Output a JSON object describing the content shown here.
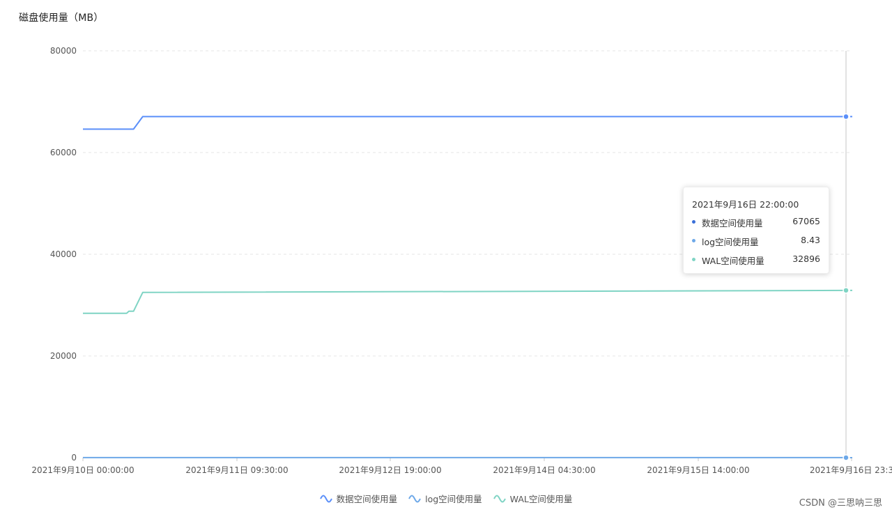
{
  "chart_data": {
    "type": "line",
    "title": "磁盘使用量（MB）",
    "xlabel": "",
    "ylabel": "",
    "ylim": [
      0,
      80000
    ],
    "yticks": [
      0,
      20000,
      40000,
      60000,
      80000
    ],
    "yticks_text": [
      "0",
      "20000",
      "40000",
      "60000",
      "80000"
    ],
    "xlim": [
      "2021-09-10 00:00:00",
      "2021-09-16 22:00:00"
    ],
    "xtick_labels": [
      "2021年9月10日 00:00:00",
      "2021年9月11日 09:30:00",
      "2021年9月12日 19:00:00",
      "2021年9月14日 04:30:00",
      "2021年9月15日 14:00:00",
      "2021年9月16日 23:3"
    ],
    "grid": "horizontal dashed",
    "legend_position": "bottom",
    "series": [
      {
        "name": "数据空间使用量",
        "color": "#5b8ff9",
        "x": [
          "2021-09-10 00:00:00",
          "2021-09-10 11:00:00",
          "2021-09-10 13:00:00",
          "2021-09-16 22:00:00"
        ],
        "y": [
          64600,
          64600,
          67065,
          67065
        ]
      },
      {
        "name": "log空间使用量",
        "color": "#6da8e8",
        "x": [
          "2021-09-10 00:00:00",
          "2021-09-16 22:00:00"
        ],
        "y": [
          8.43,
          8.43
        ]
      },
      {
        "name": "WAL空间使用量",
        "color": "#7fd4c4",
        "x": [
          "2021-09-10 00:00:00",
          "2021-09-10 09:30:00",
          "2021-09-10 10:00:00",
          "2021-09-10 11:00:00",
          "2021-09-10 13:00:00",
          "2021-09-16 22:00:00"
        ],
        "y": [
          28400,
          28400,
          28800,
          28800,
          32500,
          32896
        ]
      }
    ],
    "tooltip": {
      "title": "2021年9月16日 22:00:00",
      "rows": [
        {
          "name": "数据空间使用量",
          "value": "67065",
          "color": "#3a6fd8"
        },
        {
          "name": "log空间使用量",
          "value": "8.43",
          "color": "#6da8e8"
        },
        {
          "name": "WAL空间使用量",
          "value": "32896",
          "color": "#7fd4c4"
        }
      ]
    }
  },
  "watermark": "CSDN @三思呐三思"
}
